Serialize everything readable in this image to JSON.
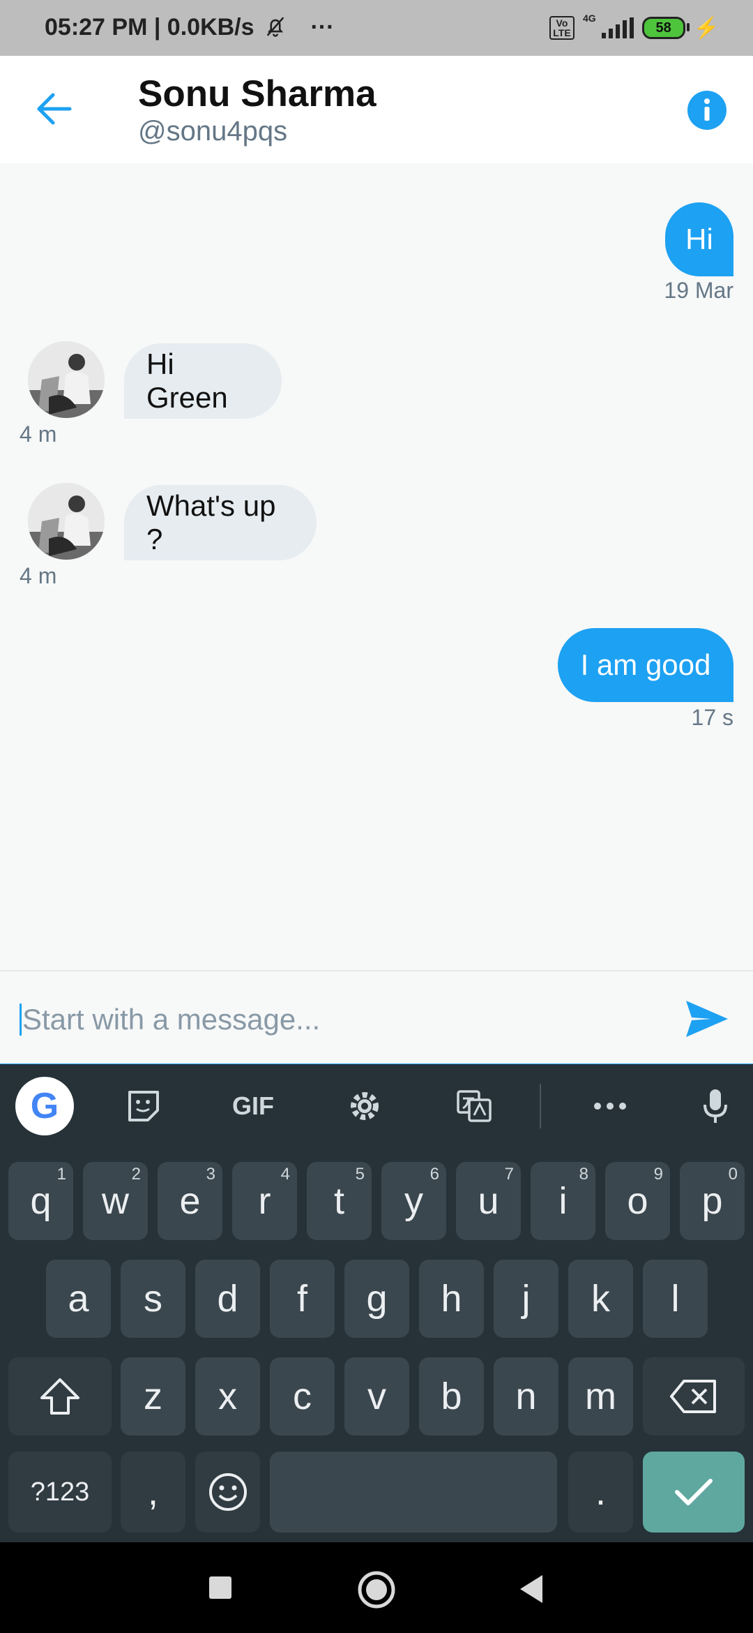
{
  "status": {
    "time_speed": "05:27 PM | 0.0KB/s",
    "more": "···",
    "volte": "Vo\nLTE",
    "net_type": "4G",
    "battery": "58",
    "charging": "⚡"
  },
  "header": {
    "name": "Sonu Sharma",
    "handle": "@sonu4pqs"
  },
  "messages": [
    {
      "direction": "out",
      "text": "Hi",
      "time": "19 Mar"
    },
    {
      "direction": "in",
      "text": "Hi Green",
      "time": "4 m"
    },
    {
      "direction": "in",
      "text": "What's up ?",
      "time": "4 m"
    },
    {
      "direction": "out",
      "text": "I am good",
      "time": "17 s"
    }
  ],
  "composer": {
    "placeholder": "Start with a message..."
  },
  "keyboard": {
    "google": "G",
    "gif": "GIF",
    "row1": [
      "q",
      "w",
      "e",
      "r",
      "t",
      "y",
      "u",
      "i",
      "o",
      "p"
    ],
    "row1_hints": [
      "1",
      "2",
      "3",
      "4",
      "5",
      "6",
      "7",
      "8",
      "9",
      "0"
    ],
    "row2": [
      "a",
      "s",
      "d",
      "f",
      "g",
      "h",
      "j",
      "k",
      "l"
    ],
    "row3": [
      "z",
      "x",
      "c",
      "v",
      "b",
      "n",
      "m"
    ],
    "symbols": "?123",
    "comma": ",",
    "period": "."
  },
  "colors": {
    "accent": "#1da1f2",
    "incoming_bubble": "#e6ecf0",
    "keyboard_bg": "#263238"
  }
}
